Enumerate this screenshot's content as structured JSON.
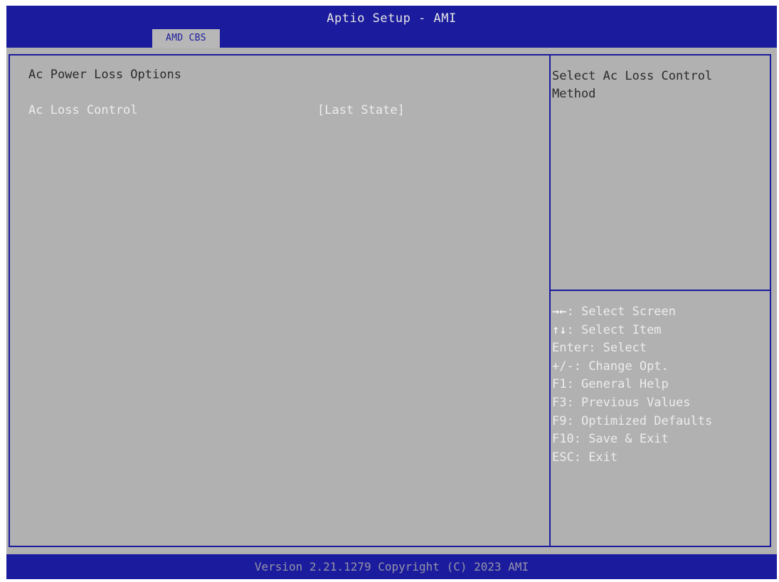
{
  "header": {
    "title": "Aptio Setup - AMI",
    "tabs": [
      {
        "label": "AMD CBS"
      }
    ]
  },
  "main": {
    "section_heading": "Ac Power Loss Options",
    "settings": [
      {
        "label": "Ac Loss Control",
        "value": "[Last State]"
      }
    ]
  },
  "help": {
    "description": "Select Ac Loss Control Method"
  },
  "keys": [
    {
      "key": "→←",
      "action": ": Select Screen"
    },
    {
      "key": "↑↓",
      "action": ": Select Item"
    },
    {
      "key": "Enter",
      "action": ": Select"
    },
    {
      "key": "+/-",
      "action": ": Change Opt."
    },
    {
      "key": "F1",
      "action": ": General Help"
    },
    {
      "key": "F3",
      "action": ": Previous Values"
    },
    {
      "key": "F9",
      "action": ": Optimized Defaults"
    },
    {
      "key": "F10",
      "action": ": Save & Exit"
    },
    {
      "key": "ESC",
      "action": ": Exit"
    }
  ],
  "footer": {
    "version": "Version 2.21.1279 Copyright (C) 2023 AMI"
  },
  "colors": {
    "title_bar": "#1b1b9d",
    "background": "#b1b1b1",
    "highlight_text": "#ececec",
    "normal_text": "#2b2b2b"
  }
}
